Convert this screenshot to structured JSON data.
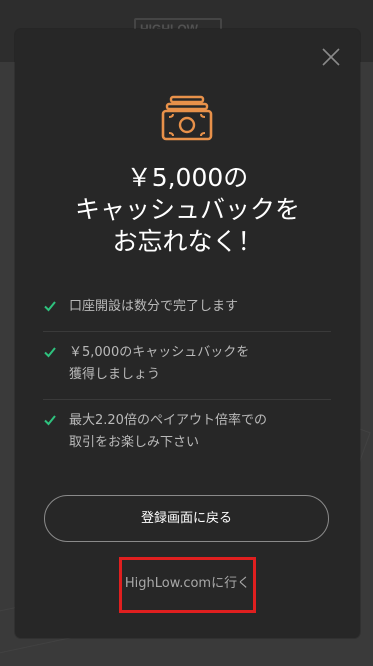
{
  "background": {
    "logo_text": "HIGHLOW"
  },
  "modal": {
    "close_icon": "close-icon",
    "hero_icon": "cash-icon",
    "headline": {
      "line1": "￥5,000の",
      "line2": "キャッシュバックを",
      "line3": "お忘れなく！"
    },
    "features": [
      {
        "icon": "check-icon",
        "lines": [
          "口座開設は数分で完了します"
        ]
      },
      {
        "icon": "check-icon",
        "lines": [
          "￥5,000のキャッシュバックを",
          "獲得しましょう"
        ]
      },
      {
        "icon": "check-icon",
        "lines": [
          "最大2.20倍のペイアウト倍率での",
          "取引をお楽しみ下さい"
        ]
      }
    ],
    "register_button_label": "登録画面に戻る",
    "goto_link_label": "HighLow.comに行く"
  },
  "colors": {
    "overlay_background": "#3a3a3a",
    "modal_background": "#272727",
    "accent_orange": "#e8914a",
    "check_green": "#2ec27e",
    "highlight_red": "#e01f1f"
  }
}
